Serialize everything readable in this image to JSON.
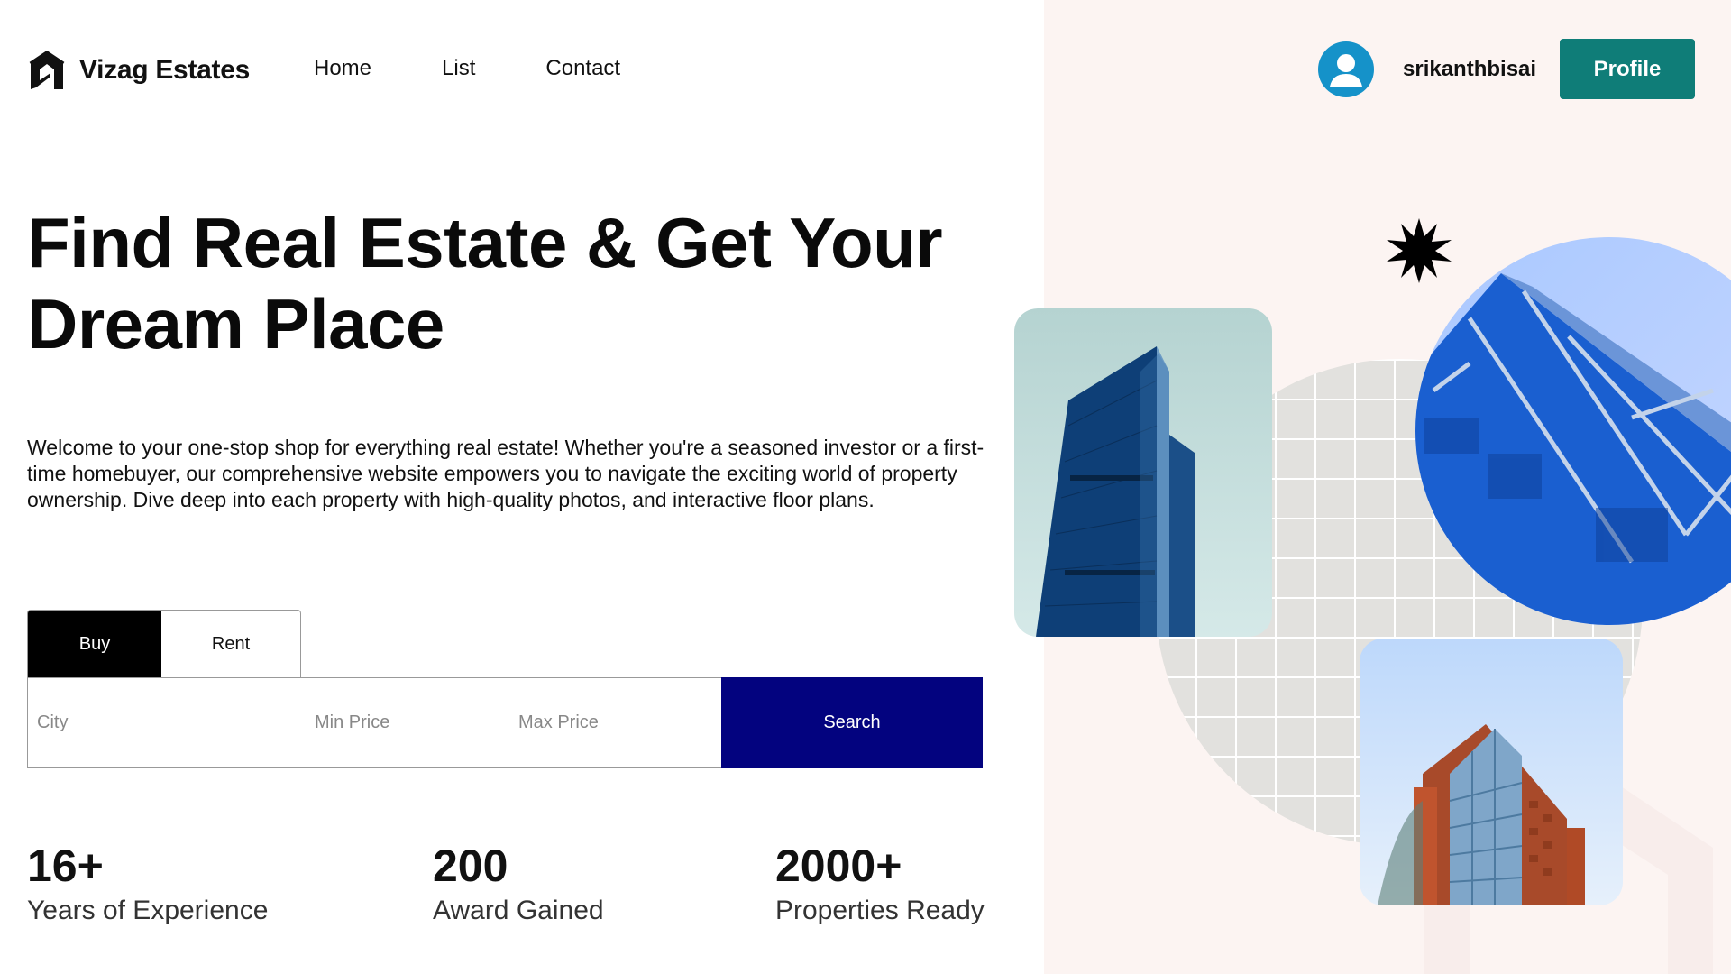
{
  "brand": {
    "name": "Vizag Estates",
    "icon": "logo-icon"
  },
  "nav": {
    "items": [
      "Home",
      "List",
      "Contact"
    ]
  },
  "user": {
    "username": "srikanthbisai",
    "avatar_icon": "user-avatar-icon",
    "profile_label": "Profile"
  },
  "hero": {
    "title_line1": "Find Real Estate & Get Your",
    "title_line2": "Dream Place",
    "description": "Welcome to your one-stop shop for everything real estate! Whether you're a seasoned investor or a first-time homebuyer, our comprehensive website empowers you to navigate the exciting world of property ownership. Dive deep into each property with high-quality photos, and interactive floor plans."
  },
  "search": {
    "tabs": [
      "Buy",
      "Rent"
    ],
    "active_tab": "Buy",
    "city_placeholder": "City",
    "min_price_placeholder": "Min Price",
    "max_price_placeholder": "Max Price",
    "button_label": "Search"
  },
  "stats": [
    {
      "value": "16+",
      "label": "Years of Experience"
    },
    {
      "value": "200",
      "label": "Award Gained"
    },
    {
      "value": "2000+",
      "label": "Properties Ready"
    }
  ],
  "colors": {
    "profile_button": "#0f7d78",
    "search_button": "#03037f",
    "active_tab": "#000000",
    "right_panel": "#fcf4f2",
    "avatar": "#1592c9"
  }
}
